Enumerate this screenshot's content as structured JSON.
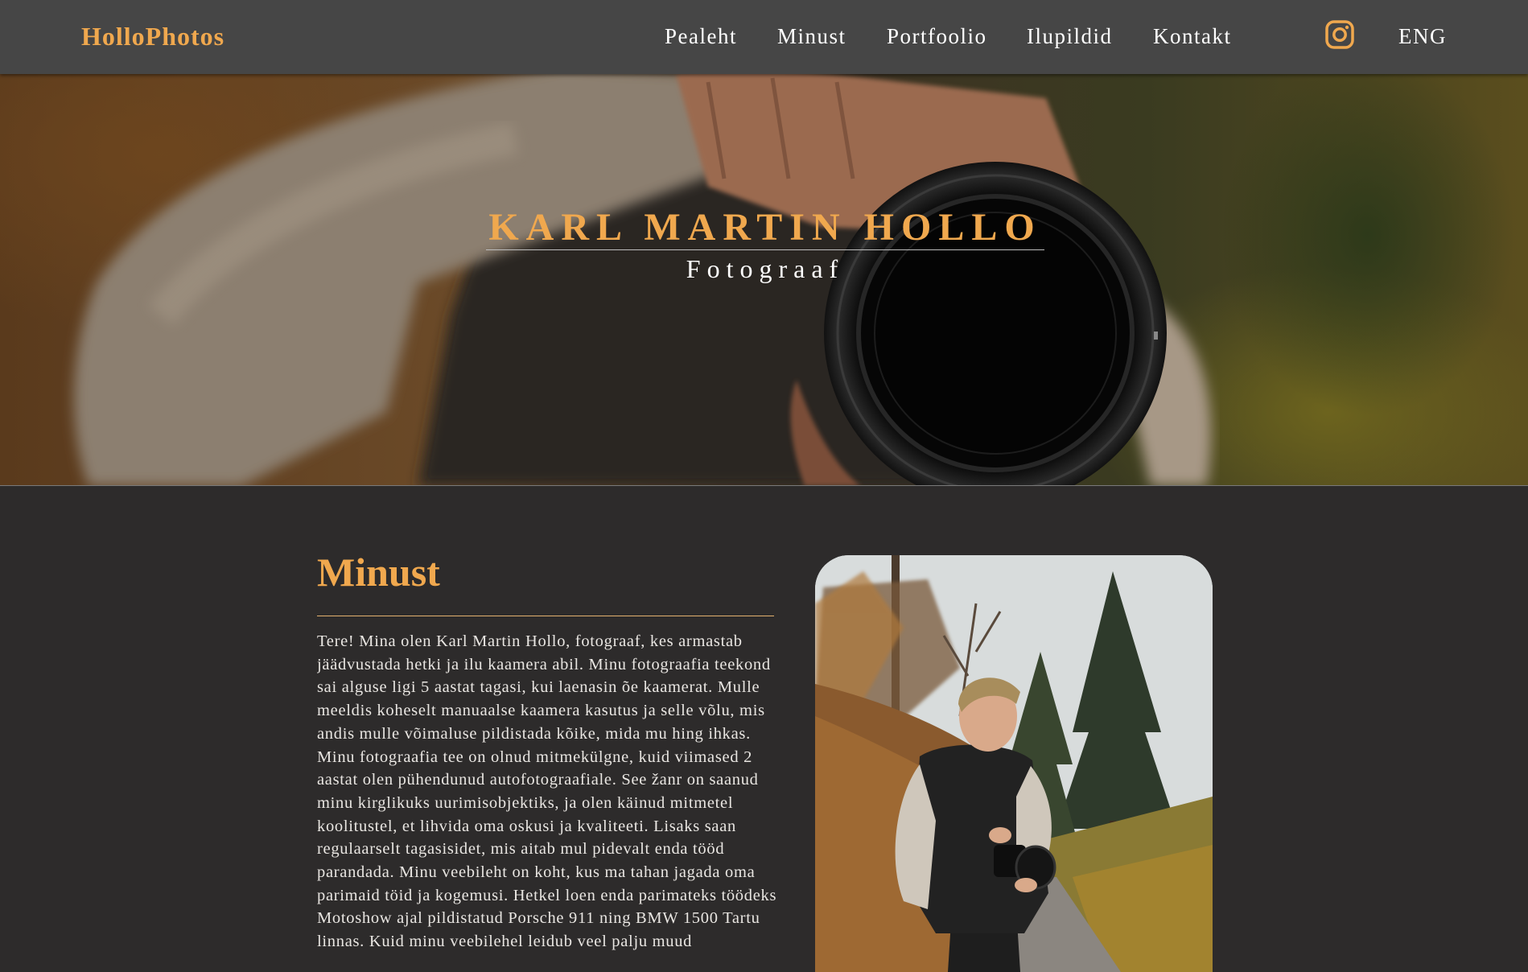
{
  "brand": {
    "logo": "HolloPhotos",
    "accent_color": "#f0a84e"
  },
  "nav": {
    "items": [
      {
        "label": "Pealeht"
      },
      {
        "label": "Minust"
      },
      {
        "label": "Portfoolio"
      },
      {
        "label": "Ilupildid"
      },
      {
        "label": "Kontakt"
      }
    ],
    "social_icon": "instagram-icon",
    "language": "ENG"
  },
  "hero": {
    "title": "KARL MARTIN HOLLO",
    "subtitle": "Fotograaf"
  },
  "about": {
    "heading": "Minust",
    "body": "Tere! Mina olen Karl Martin Hollo, fotograaf, kes armastab jäädvustada hetki ja ilu kaamera abil. Minu fotograafia teekond sai alguse ligi 5 aastat tagasi, kui laenasin õe kaamerat. Mulle meeldis koheselt manuaalse kaamera kasutus ja selle võlu, mis andis mulle võimaluse pildistada kõike, mida mu hing ihkas. Minu fotograafia tee on olnud mitmekülgne, kuid viimased 2 aastat olen pühendunud autofotograafiale. See žanr on saanud minu kirglikuks uurimisobjektiks, ja olen käinud mitmetel koolitustel, et lihvida oma oskusi ja kvaliteeti. Lisaks saan regulaarselt tagasisidet, mis aitab mul pidevalt enda tööd parandada. Minu veebileht on koht, kus ma tahan jagada oma parimaid töid ja kogemusi. Hetkel loen enda parimateks töödeks Motoshow ajal pildistatud Porsche 911 ning BMW 1500 Tartu linnas. Kuid minu veebilehel leidub veel palju muud"
  },
  "colors": {
    "navbar_bg": "#464646",
    "page_bg": "#2d2b2b",
    "text": "#e9e6e2"
  }
}
